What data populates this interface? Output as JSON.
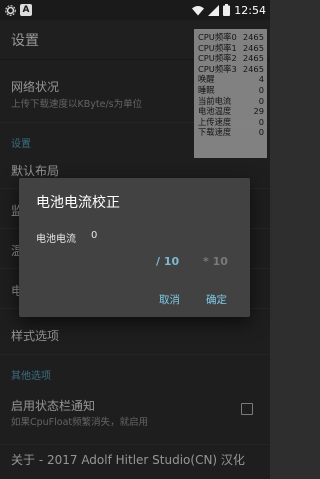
{
  "status_bar": {
    "time": "12:54",
    "left_icons": [
      "settings-icon",
      "app-a-icon"
    ],
    "right_icons": [
      "wifi-icon",
      "signal-icon",
      "battery-icon"
    ]
  },
  "toolbar": {
    "title": "设置"
  },
  "list": {
    "network": {
      "title": "网络状况",
      "subtitle": "上传下载速度以KByte/s为单位"
    },
    "section_settings": "设置",
    "default_layout": {
      "title": "默认布局"
    },
    "row_partial_1": "监",
    "row_partial_2": "温",
    "row_partial_3": "电",
    "style_options": {
      "title": "样式选项"
    },
    "section_other": "其他选项",
    "statusbar_notify": {
      "title": "启用状态栏通知",
      "subtitle": "如果CpuFloat频繁消失，就启用"
    },
    "about": {
      "title": "关于 - 2017 Adolf Hitler Studio(CN) 汉化"
    }
  },
  "monitor": [
    {
      "label": "CPU频率0",
      "value": "2465"
    },
    {
      "label": "CPU频率1",
      "value": "2465"
    },
    {
      "label": "CPU频率2",
      "value": "2465"
    },
    {
      "label": "CPU频率3",
      "value": "2465"
    },
    {
      "label": "唤醒",
      "value": "4"
    },
    {
      "label": "睡眠",
      "value": "0"
    },
    {
      "label": "当前电流",
      "value": "0"
    },
    {
      "label": "电池温度",
      "value": "29"
    },
    {
      "label": "上传速度",
      "value": "0"
    },
    {
      "label": "下载速度",
      "value": "0"
    }
  ],
  "dialog": {
    "title": "电池电流校正",
    "label": "电池电流",
    "value": "0",
    "option_divide": "/ 10",
    "option_multiply": "* 10",
    "cancel": "取消",
    "ok": "确定"
  },
  "colors": {
    "accent": "#7fcbe8",
    "section": "#5ba8c8",
    "background": "#2e2e2e",
    "dialog": "#424242"
  }
}
